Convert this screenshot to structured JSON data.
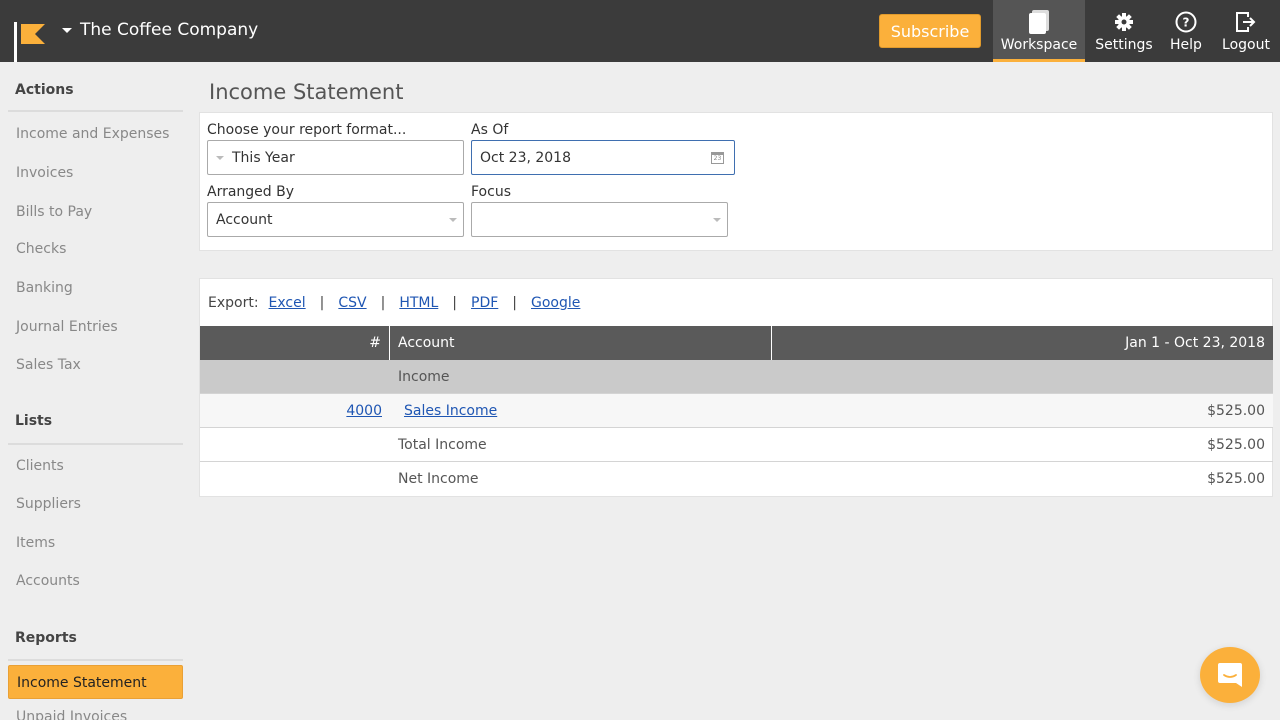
{
  "header": {
    "company_name": "The Coffee Company",
    "subscribe_label": "Subscribe",
    "nav": [
      {
        "label": "Workspace",
        "icon": "workspace-icon",
        "active": true
      },
      {
        "label": "Settings",
        "icon": "gear-icon"
      },
      {
        "label": "Help",
        "icon": "help-icon"
      },
      {
        "label": "Logout",
        "icon": "logout-icon"
      }
    ],
    "accent_color": "#fbb03b"
  },
  "sidebar": {
    "sections": [
      {
        "title": "Actions",
        "items": [
          "Income and Expenses",
          "Invoices",
          "Bills to Pay",
          "Checks",
          "Banking",
          "Journal Entries",
          "Sales Tax"
        ]
      },
      {
        "title": "Lists",
        "items": [
          "Clients",
          "Suppliers",
          "Items",
          "Accounts"
        ]
      },
      {
        "title": "Reports",
        "items": [
          "Income Statement",
          "Unpaid Invoices"
        ],
        "active_item": "Income Statement"
      }
    ]
  },
  "main": {
    "page_title": "Income Statement",
    "form": {
      "format_label": "Choose your report format...",
      "format_value": "This Year",
      "as_of_label": "As Of",
      "as_of_value": "Oct 23, 2018",
      "calendar_day": "23",
      "arranged_by_label": "Arranged By",
      "arranged_by_value": "Account",
      "focus_label": "Focus",
      "focus_value": ""
    },
    "export": {
      "label": "Export:",
      "links": [
        "Excel",
        "CSV",
        "HTML",
        "PDF",
        "Google"
      ],
      "separator": "|"
    },
    "table": {
      "headers": {
        "number": "#",
        "account": "Account",
        "period": "Jan 1 - Oct 23, 2018"
      },
      "rows": [
        {
          "type": "section",
          "number": "",
          "account": "Income",
          "amount": ""
        },
        {
          "type": "detail",
          "number": "4000",
          "account": "Sales Income",
          "amount": "$525.00"
        },
        {
          "type": "total",
          "number": "",
          "account": "Total Income",
          "amount": "$525.00"
        },
        {
          "type": "total",
          "number": "",
          "account": "Net Income",
          "amount": "$525.00"
        }
      ]
    }
  },
  "chat": {
    "icon": "chat-icon"
  }
}
